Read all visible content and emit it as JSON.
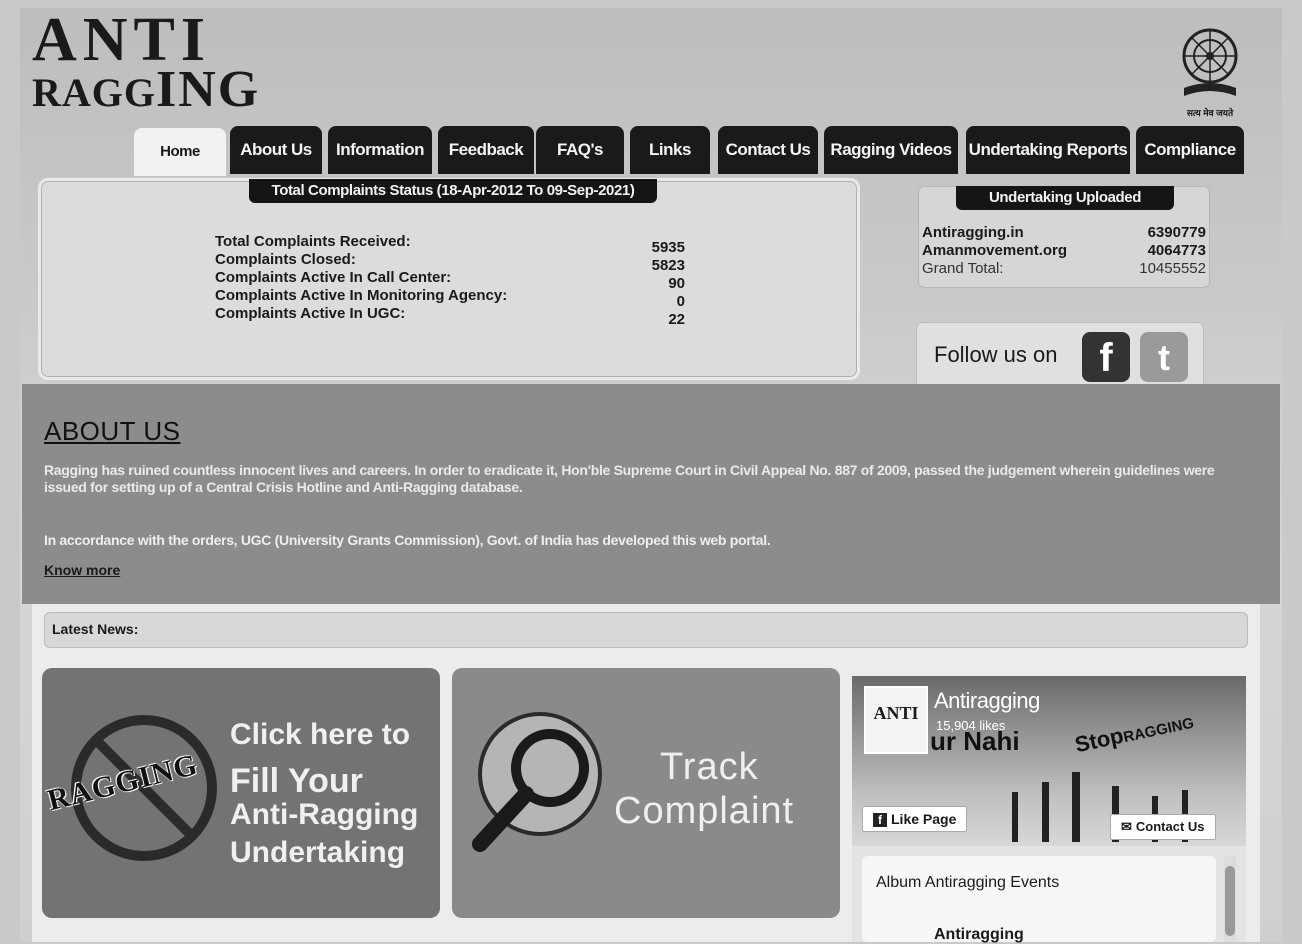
{
  "logo": {
    "line1": "ANTI",
    "line2a": "RAGG",
    "line2b": "ING"
  },
  "emblem": {
    "caption": "सत्य मेव जयते"
  },
  "nav": {
    "tabs": [
      "Home",
      "About Us",
      "Information",
      "Feedback",
      "FAQ's",
      "Links",
      "Contact Us",
      "Ragging Videos",
      "Undertaking Reports",
      "Compliance"
    ],
    "active": "Home"
  },
  "complaints": {
    "title": "Total Complaints Status (18-Apr-2012 To 09-Sep-2021)",
    "rows": [
      {
        "label": "Total Complaints Received:",
        "value": "5935"
      },
      {
        "label": "Complaints Closed:",
        "value": "5823"
      },
      {
        "label": "Complaints Active In Call Center:",
        "value": "90"
      },
      {
        "label": "Complaints Active In Monitoring Agency:",
        "value": "0"
      },
      {
        "label": "Complaints Active In UGC:",
        "value": "22"
      }
    ]
  },
  "undertaking": {
    "title": "Undertaking Uploaded",
    "rows": [
      {
        "label": "Antiragging.in",
        "value": "6390779"
      },
      {
        "label": "Amanmovement.org",
        "value": "4064773"
      },
      {
        "label": "Grand Total:",
        "value": "10455552"
      }
    ]
  },
  "follow": {
    "text": "Follow us on",
    "icons": [
      "facebook-icon",
      "twitter-icon"
    ]
  },
  "about": {
    "heading": "ABOUT US",
    "p1": "Ragging has ruined countless innocent lives and careers. In order to eradicate it, Hon'ble Supreme Court in Civil Appeal No. 887 of 2009, passed the judgement wherein guidelines were issued for setting up of a Central Crisis Hotline and Anti-Ragging database.",
    "p2": "In accordance with the orders, UGC (University Grants Commission), Govt. of India has developed this web portal.",
    "more": "Know more"
  },
  "news": {
    "label": "Latest News:"
  },
  "card_undertaking": {
    "stamp": "RAGGING",
    "line1": "Click here to",
    "line2": "Fill Your",
    "line3": "Anti-Ragging",
    "line4": "Undertaking"
  },
  "card_track": {
    "line1": "Track",
    "line2": "Complaint"
  },
  "facebook": {
    "thumb": "ANTI",
    "name": "Antiragging",
    "likes": "15,904 likes",
    "cover_text": "ur Nahi",
    "cover_stop": "Stop",
    "cover_ragging": "RAGGING",
    "like_button": "Like Page",
    "contact_button": "Contact Us",
    "album": "Album Antiragging Events",
    "post_author": "Antiragging"
  }
}
